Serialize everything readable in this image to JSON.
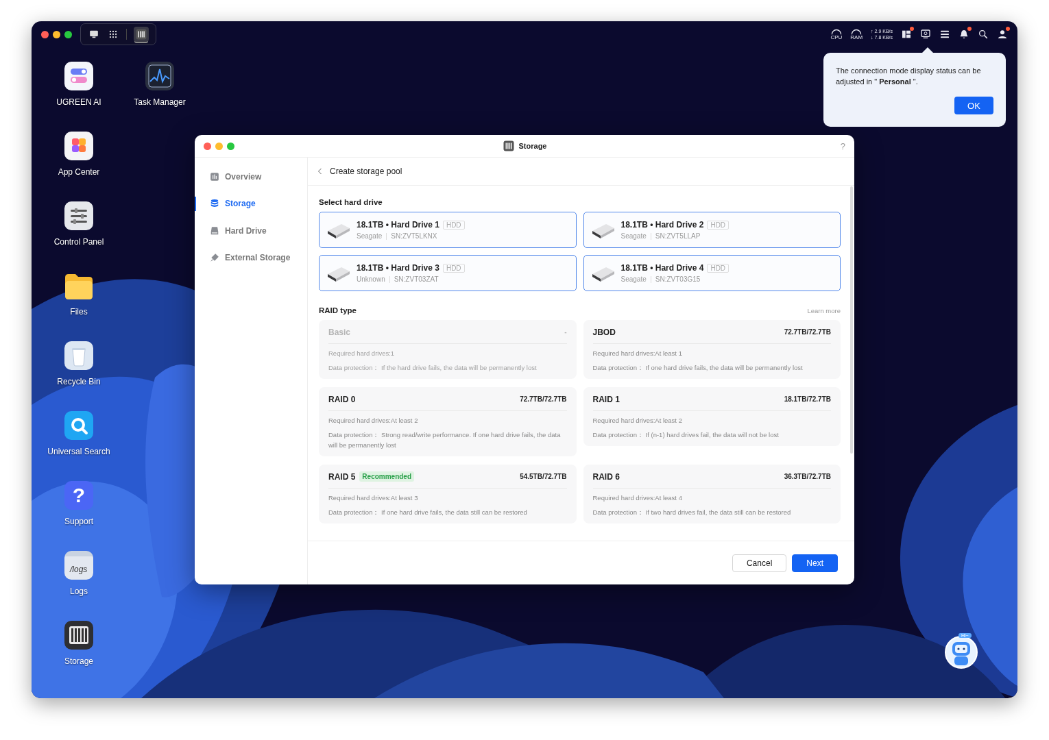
{
  "desktop": {
    "toolbar": [
      {
        "kind": "monitor",
        "selected": false
      },
      {
        "kind": "grid",
        "selected": false
      },
      {
        "kind": "storage",
        "selected": true
      }
    ],
    "tray": {
      "cpu_label": "CPU",
      "ram_label": "RAM",
      "upload": "↑ 2.9 KB/s",
      "download": "↓ 7.8 KB/s",
      "icons": [
        {
          "kind": "widgets",
          "badge": true
        },
        {
          "kind": "monitor",
          "badge": false
        },
        {
          "kind": "list",
          "badge": false
        },
        {
          "kind": "bell",
          "badge": true
        },
        {
          "kind": "search",
          "badge": false
        },
        {
          "kind": "user",
          "badge": true
        }
      ]
    },
    "apps": [
      {
        "label": "UGREEN AI",
        "kind": "ai"
      },
      {
        "label": "Task Manager",
        "kind": "task"
      },
      {
        "label": "App Center",
        "kind": "appcenter"
      },
      {
        "label": "Control Panel",
        "kind": "control"
      },
      {
        "label": "Files",
        "kind": "files"
      },
      {
        "label": "Recycle Bin",
        "kind": "bin"
      },
      {
        "label": "Universal Search",
        "kind": "search"
      },
      {
        "label": "Support",
        "kind": "support",
        "glyph": "?"
      },
      {
        "label": "Logs",
        "kind": "logs",
        "glyph": "/logs"
      },
      {
        "label": "Storage",
        "kind": "storage"
      }
    ],
    "popover": {
      "text": "The connection mode display status can be adjusted in \" **Personal** \".",
      "button": "OK"
    },
    "assistant": {
      "bubble": "Hi~"
    }
  },
  "storage_window": {
    "title": "Storage",
    "help": "?",
    "sidebar": [
      {
        "label": "Overview",
        "kind": "overview",
        "selected": false
      },
      {
        "label": "Storage",
        "kind": "storage",
        "selected": true
      },
      {
        "label": "Hard Drive",
        "kind": "drive",
        "selected": false
      },
      {
        "label": "External Storage",
        "kind": "external",
        "selected": false
      }
    ],
    "header": {
      "title": "Create storage pool"
    },
    "drive_section": {
      "title": "Select hard drive",
      "drives": [
        {
          "name": "18.1TB • Hard Drive 1",
          "tag": "HDD",
          "vendor": "Seagate",
          "serial": "SN:ZVT5LKNX",
          "selected": true
        },
        {
          "name": "18.1TB • Hard Drive 2",
          "tag": "HDD",
          "vendor": "Seagate",
          "serial": "SN:ZVT5LLAP",
          "selected": true
        },
        {
          "name": "18.1TB • Hard Drive 3",
          "tag": "HDD",
          "vendor": "Unknown",
          "serial": "SN:ZVT03ZAT",
          "selected": true
        },
        {
          "name": "18.1TB • Hard Drive 4",
          "tag": "HDD",
          "vendor": "Seagate",
          "serial": "SN:ZVT03G15",
          "selected": true
        }
      ]
    },
    "raid_section": {
      "title": "RAID type",
      "link": "Learn more",
      "options": [
        {
          "name": "Basic",
          "capacity": "-",
          "required": "Required hard drives:1",
          "protection": "Data protection：  If the hard drive fails, the data will be permanently lost",
          "disabled": true,
          "selected": false
        },
        {
          "name": "JBOD",
          "capacity": "72.7TB/72.7TB",
          "required": "Required hard drives:At least 1",
          "protection": "Data protection：  If one hard drive fails, the data will be permanently lost",
          "disabled": false,
          "selected": false
        },
        {
          "name": "RAID 0",
          "capacity": "72.7TB/72.7TB",
          "required": "Required hard drives:At least 2",
          "protection": "Data protection：  Strong read/write performance. If one hard drive fails, the data will be permanently lost",
          "disabled": false,
          "selected": false
        },
        {
          "name": "RAID 1",
          "capacity": "18.1TB/72.7TB",
          "required": "Required hard drives:At least 2",
          "protection": "Data protection：  If (n-1) hard drives fail, the data will not be lost",
          "disabled": false,
          "selected": false
        },
        {
          "name": "RAID 5",
          "badge": "Recommended",
          "capacity": "54.5TB/72.7TB",
          "required": "Required hard drives:At least 3",
          "protection": "Data protection：  If one hard drive fails, the data still can be restored",
          "disabled": false,
          "selected": false
        },
        {
          "name": "RAID 6",
          "capacity": "36.3TB/72.7TB",
          "required": "Required hard drives:At least 4",
          "protection": "Data protection：  If two hard drives fail, the data still can be restored",
          "disabled": false,
          "selected": false
        }
      ]
    },
    "buttons": {
      "cancel": "Cancel",
      "next": "Next"
    }
  }
}
